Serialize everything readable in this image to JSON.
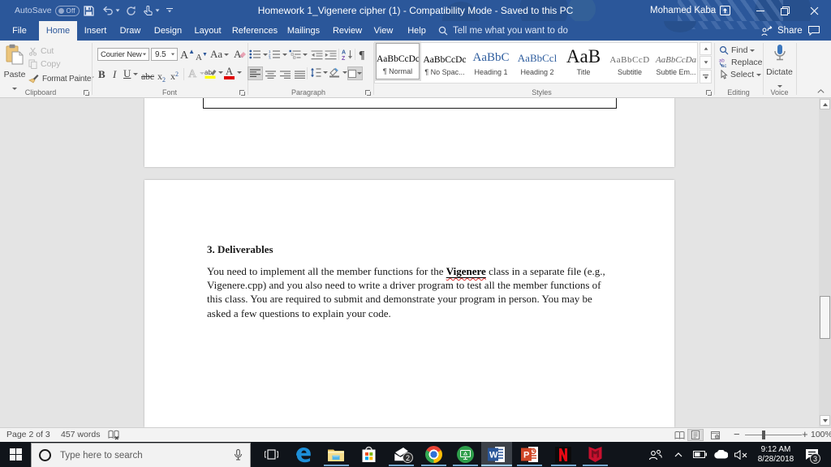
{
  "titlebar": {
    "autosave_label": "AutoSave",
    "autosave_state": "Off",
    "title": "Homework 1_Vigenere cipher (1)  -  Compatibility Mode  -  Saved to this PC",
    "user": "Mohamed Kaba"
  },
  "tabs": {
    "items": [
      "File",
      "Home",
      "Insert",
      "Draw",
      "Design",
      "Layout",
      "References",
      "Mailings",
      "Review",
      "View",
      "Help"
    ],
    "active": "Home",
    "search_placeholder": "Tell me what you want to do",
    "share_label": "Share"
  },
  "ribbon": {
    "clipboard": {
      "label": "Clipboard",
      "paste": "Paste",
      "cut": "Cut",
      "copy": "Copy",
      "format_painter": "Format Painter"
    },
    "font": {
      "label": "Font",
      "font_name": "Courier New",
      "font_size": "9.5"
    },
    "paragraph": {
      "label": "Paragraph"
    },
    "styles": {
      "label": "Styles",
      "items": [
        {
          "sample": "AaBbCcDc",
          "name": "¶ Normal"
        },
        {
          "sample": "AaBbCcDc",
          "name": "¶ No Spac..."
        },
        {
          "sample": "AaBbC",
          "name": "Heading 1"
        },
        {
          "sample": "AaBbCcl",
          "name": "Heading 2"
        },
        {
          "sample": "AaB",
          "name": "Title"
        },
        {
          "sample": "AaBbCcD",
          "name": "Subtitle"
        },
        {
          "sample": "AaBbCcDa",
          "name": "Subtle Em..."
        }
      ]
    },
    "editing": {
      "label": "Editing",
      "find": "Find",
      "replace": "Replace",
      "select": "Select"
    },
    "voice": {
      "label": "Voice",
      "dictate": "Dictate"
    }
  },
  "document": {
    "heading": "3. Deliverables",
    "para_l1a": "You need to implement all the member functions for the ",
    "para_l1b": "Vigenere",
    "para_l1c": " class in a separate file (e.g.,",
    "para_l2": "Vigenere.cpp) and you also need to write a driver program to test all the member functions of",
    "para_l3": "this class. You are required to submit and demonstrate your program in person. You may be",
    "para_l4": "asked a few questions to explain your code."
  },
  "statusbar": {
    "page_info": "Page 2 of 3",
    "word_count": "457 words",
    "zoom_level": "100%"
  },
  "taskbar": {
    "search_placeholder": "Type here to search",
    "time": "9:12 AM",
    "date": "8/28/2018",
    "mail_badge": "2",
    "notification_badge": "3"
  }
}
